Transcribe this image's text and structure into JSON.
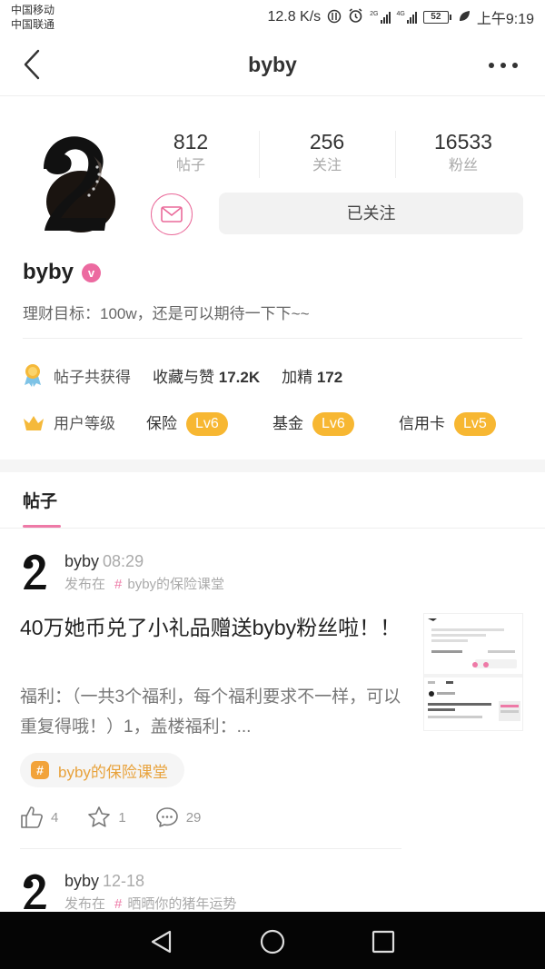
{
  "status_bar": {
    "carrier1": "中国移动",
    "carrier2": "中国联通",
    "speed": "12.8 K/s",
    "net1": "2G",
    "net2": "4G",
    "battery": "52",
    "time": "上午9:19"
  },
  "nav": {
    "title": "byby",
    "back_icon": "chevron-left-icon",
    "more_icon": "more-dots-icon"
  },
  "profile": {
    "stats": [
      {
        "value": "812",
        "label": "帖子"
      },
      {
        "value": "256",
        "label": "关注"
      },
      {
        "value": "16533",
        "label": "粉丝"
      }
    ],
    "follow_label": "已关注",
    "username": "byby",
    "verified_mark": "v",
    "bio": "理财目标：100w，还是可以期待一下下~~",
    "honor": {
      "label": "帖子共获得",
      "collect_label": "收藏与赞",
      "collect_value": "17.2K",
      "featured_label": "加精",
      "featured_value": "172"
    },
    "levels": {
      "label": "用户等级",
      "items": [
        {
          "name": "保险",
          "level": "Lv6"
        },
        {
          "name": "基金",
          "level": "Lv6"
        },
        {
          "name": "信用卡",
          "level": "Lv5"
        }
      ]
    }
  },
  "tabs": {
    "posts": "帖子"
  },
  "posts": [
    {
      "author": "byby",
      "time": "08:29",
      "posted_in": "发布在",
      "hash": "#",
      "topic": "byby的保险课堂",
      "title": "40万她币兑了小礼品赠送byby粉丝啦！！",
      "excerpt": "福利：（一共3个福利，每个福利要求不一样，可以重复得哦！）1，盖楼福利：...",
      "chip_hash": "#",
      "chip_topic": "byby的保险课堂",
      "likes": "4",
      "favorites": "1",
      "comments": "29"
    },
    {
      "author": "byby",
      "time": "12-18",
      "posted_in": "发布在",
      "hash": "#",
      "topic": "晒晒你的猪年运势"
    }
  ],
  "colors": {
    "accent_pink": "#ee7aa7",
    "level_orange": "#f7b732",
    "chip_text": "#e8a23b"
  }
}
